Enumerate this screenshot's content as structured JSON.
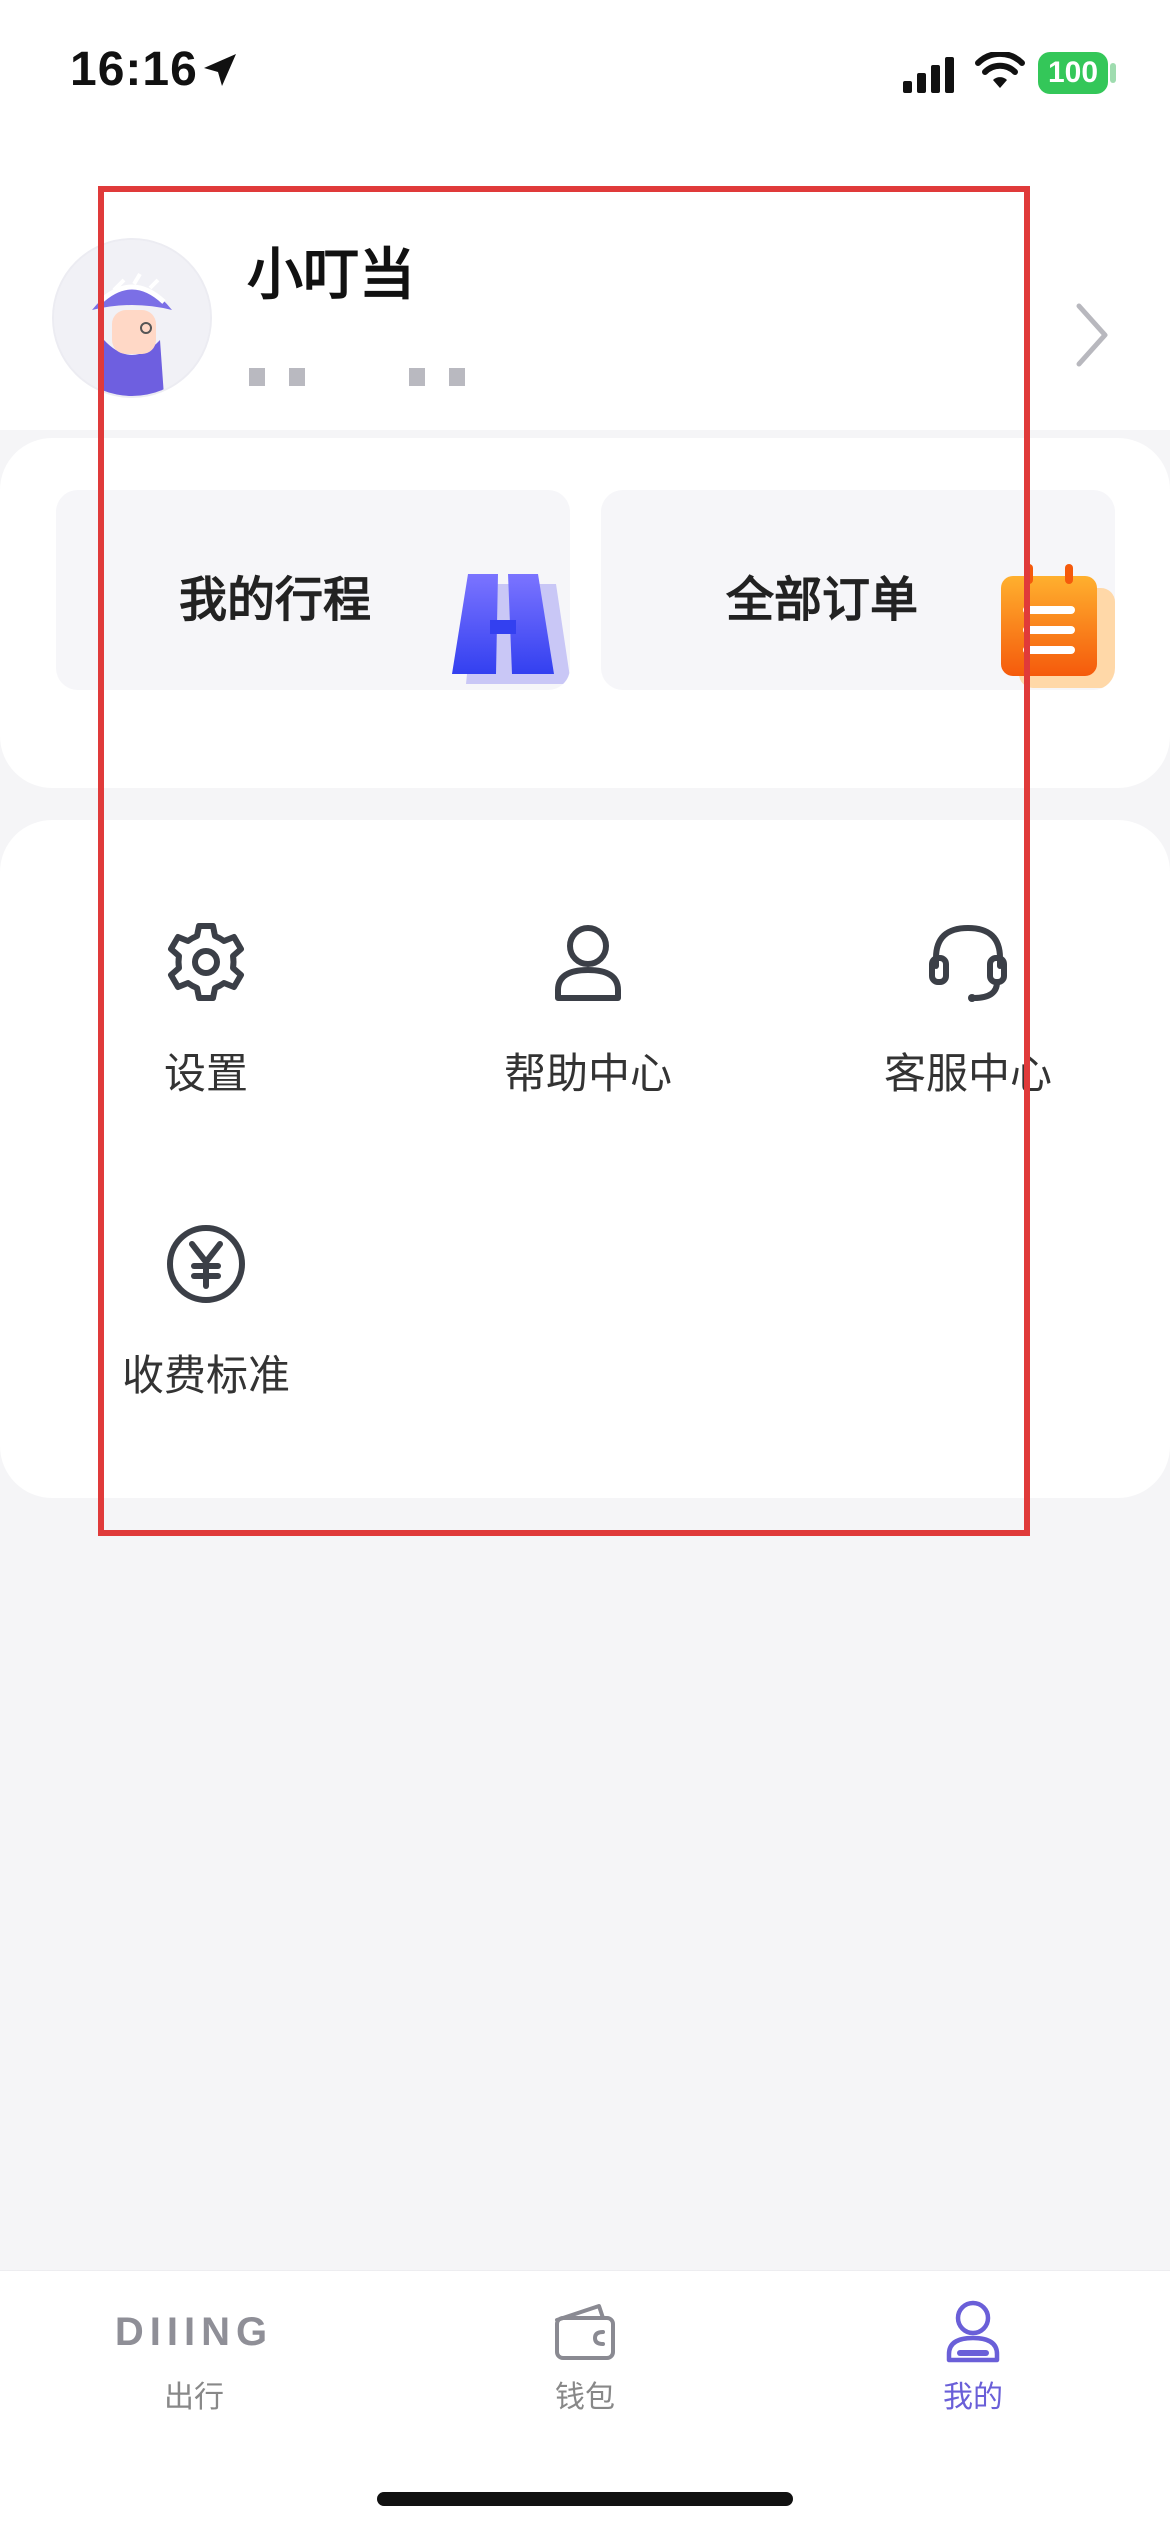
{
  "status_bar": {
    "time": "16:16",
    "battery": "100",
    "icons": [
      "location-arrow-icon",
      "signal-icon",
      "wifi-icon",
      "battery-icon"
    ],
    "battery_color": "#34c759"
  },
  "profile": {
    "name": "小叮当",
    "phone_masked": true,
    "chevron_icon": "chevron-right-icon"
  },
  "shortcuts": [
    {
      "label": "我的行程",
      "icon": "trip-icon",
      "accent": "#4b57f0"
    },
    {
      "label": "全部订单",
      "icon": "orders-icon",
      "accent": "#f7891e"
    }
  ],
  "services": [
    {
      "label": "设置",
      "icon": "gear-icon"
    },
    {
      "label": "帮助中心",
      "icon": "user-help-icon"
    },
    {
      "label": "客服中心",
      "icon": "headset-icon"
    },
    {
      "label": "收费标准",
      "icon": "yuan-icon"
    }
  ],
  "tab_bar": {
    "brand_logo": "DIIING",
    "tabs": [
      {
        "label": "出行",
        "icon": "diiing-logo"
      },
      {
        "label": "钱包",
        "icon": "wallet-icon"
      },
      {
        "label": "我的",
        "icon": "user-icon",
        "active": true
      }
    ],
    "active_color": "#6a5fd8",
    "inactive_color": "#888888"
  },
  "highlight_color": "#e03a3a"
}
